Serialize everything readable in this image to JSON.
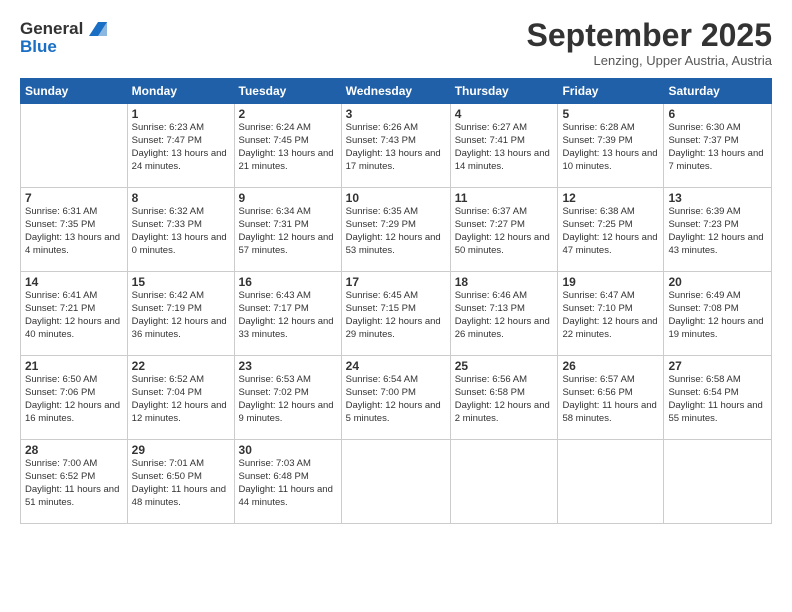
{
  "header": {
    "logo_line1": "General",
    "logo_line2": "Blue",
    "month": "September 2025",
    "location": "Lenzing, Upper Austria, Austria"
  },
  "weekdays": [
    "Sunday",
    "Monday",
    "Tuesday",
    "Wednesday",
    "Thursday",
    "Friday",
    "Saturday"
  ],
  "weeks": [
    [
      {
        "day": "",
        "sunrise": "",
        "sunset": "",
        "daylight": ""
      },
      {
        "day": "1",
        "sunrise": "Sunrise: 6:23 AM",
        "sunset": "Sunset: 7:47 PM",
        "daylight": "Daylight: 13 hours and 24 minutes."
      },
      {
        "day": "2",
        "sunrise": "Sunrise: 6:24 AM",
        "sunset": "Sunset: 7:45 PM",
        "daylight": "Daylight: 13 hours and 21 minutes."
      },
      {
        "day": "3",
        "sunrise": "Sunrise: 6:26 AM",
        "sunset": "Sunset: 7:43 PM",
        "daylight": "Daylight: 13 hours and 17 minutes."
      },
      {
        "day": "4",
        "sunrise": "Sunrise: 6:27 AM",
        "sunset": "Sunset: 7:41 PM",
        "daylight": "Daylight: 13 hours and 14 minutes."
      },
      {
        "day": "5",
        "sunrise": "Sunrise: 6:28 AM",
        "sunset": "Sunset: 7:39 PM",
        "daylight": "Daylight: 13 hours and 10 minutes."
      },
      {
        "day": "6",
        "sunrise": "Sunrise: 6:30 AM",
        "sunset": "Sunset: 7:37 PM",
        "daylight": "Daylight: 13 hours and 7 minutes."
      }
    ],
    [
      {
        "day": "7",
        "sunrise": "Sunrise: 6:31 AM",
        "sunset": "Sunset: 7:35 PM",
        "daylight": "Daylight: 13 hours and 4 minutes."
      },
      {
        "day": "8",
        "sunrise": "Sunrise: 6:32 AM",
        "sunset": "Sunset: 7:33 PM",
        "daylight": "Daylight: 13 hours and 0 minutes."
      },
      {
        "day": "9",
        "sunrise": "Sunrise: 6:34 AM",
        "sunset": "Sunset: 7:31 PM",
        "daylight": "Daylight: 12 hours and 57 minutes."
      },
      {
        "day": "10",
        "sunrise": "Sunrise: 6:35 AM",
        "sunset": "Sunset: 7:29 PM",
        "daylight": "Daylight: 12 hours and 53 minutes."
      },
      {
        "day": "11",
        "sunrise": "Sunrise: 6:37 AM",
        "sunset": "Sunset: 7:27 PM",
        "daylight": "Daylight: 12 hours and 50 minutes."
      },
      {
        "day": "12",
        "sunrise": "Sunrise: 6:38 AM",
        "sunset": "Sunset: 7:25 PM",
        "daylight": "Daylight: 12 hours and 47 minutes."
      },
      {
        "day": "13",
        "sunrise": "Sunrise: 6:39 AM",
        "sunset": "Sunset: 7:23 PM",
        "daylight": "Daylight: 12 hours and 43 minutes."
      }
    ],
    [
      {
        "day": "14",
        "sunrise": "Sunrise: 6:41 AM",
        "sunset": "Sunset: 7:21 PM",
        "daylight": "Daylight: 12 hours and 40 minutes."
      },
      {
        "day": "15",
        "sunrise": "Sunrise: 6:42 AM",
        "sunset": "Sunset: 7:19 PM",
        "daylight": "Daylight: 12 hours and 36 minutes."
      },
      {
        "day": "16",
        "sunrise": "Sunrise: 6:43 AM",
        "sunset": "Sunset: 7:17 PM",
        "daylight": "Daylight: 12 hours and 33 minutes."
      },
      {
        "day": "17",
        "sunrise": "Sunrise: 6:45 AM",
        "sunset": "Sunset: 7:15 PM",
        "daylight": "Daylight: 12 hours and 29 minutes."
      },
      {
        "day": "18",
        "sunrise": "Sunrise: 6:46 AM",
        "sunset": "Sunset: 7:13 PM",
        "daylight": "Daylight: 12 hours and 26 minutes."
      },
      {
        "day": "19",
        "sunrise": "Sunrise: 6:47 AM",
        "sunset": "Sunset: 7:10 PM",
        "daylight": "Daylight: 12 hours and 22 minutes."
      },
      {
        "day": "20",
        "sunrise": "Sunrise: 6:49 AM",
        "sunset": "Sunset: 7:08 PM",
        "daylight": "Daylight: 12 hours and 19 minutes."
      }
    ],
    [
      {
        "day": "21",
        "sunrise": "Sunrise: 6:50 AM",
        "sunset": "Sunset: 7:06 PM",
        "daylight": "Daylight: 12 hours and 16 minutes."
      },
      {
        "day": "22",
        "sunrise": "Sunrise: 6:52 AM",
        "sunset": "Sunset: 7:04 PM",
        "daylight": "Daylight: 12 hours and 12 minutes."
      },
      {
        "day": "23",
        "sunrise": "Sunrise: 6:53 AM",
        "sunset": "Sunset: 7:02 PM",
        "daylight": "Daylight: 12 hours and 9 minutes."
      },
      {
        "day": "24",
        "sunrise": "Sunrise: 6:54 AM",
        "sunset": "Sunset: 7:00 PM",
        "daylight": "Daylight: 12 hours and 5 minutes."
      },
      {
        "day": "25",
        "sunrise": "Sunrise: 6:56 AM",
        "sunset": "Sunset: 6:58 PM",
        "daylight": "Daylight: 12 hours and 2 minutes."
      },
      {
        "day": "26",
        "sunrise": "Sunrise: 6:57 AM",
        "sunset": "Sunset: 6:56 PM",
        "daylight": "Daylight: 11 hours and 58 minutes."
      },
      {
        "day": "27",
        "sunrise": "Sunrise: 6:58 AM",
        "sunset": "Sunset: 6:54 PM",
        "daylight": "Daylight: 11 hours and 55 minutes."
      }
    ],
    [
      {
        "day": "28",
        "sunrise": "Sunrise: 7:00 AM",
        "sunset": "Sunset: 6:52 PM",
        "daylight": "Daylight: 11 hours and 51 minutes."
      },
      {
        "day": "29",
        "sunrise": "Sunrise: 7:01 AM",
        "sunset": "Sunset: 6:50 PM",
        "daylight": "Daylight: 11 hours and 48 minutes."
      },
      {
        "day": "30",
        "sunrise": "Sunrise: 7:03 AM",
        "sunset": "Sunset: 6:48 PM",
        "daylight": "Daylight: 11 hours and 44 minutes."
      },
      {
        "day": "",
        "sunrise": "",
        "sunset": "",
        "daylight": ""
      },
      {
        "day": "",
        "sunrise": "",
        "sunset": "",
        "daylight": ""
      },
      {
        "day": "",
        "sunrise": "",
        "sunset": "",
        "daylight": ""
      },
      {
        "day": "",
        "sunrise": "",
        "sunset": "",
        "daylight": ""
      }
    ]
  ]
}
